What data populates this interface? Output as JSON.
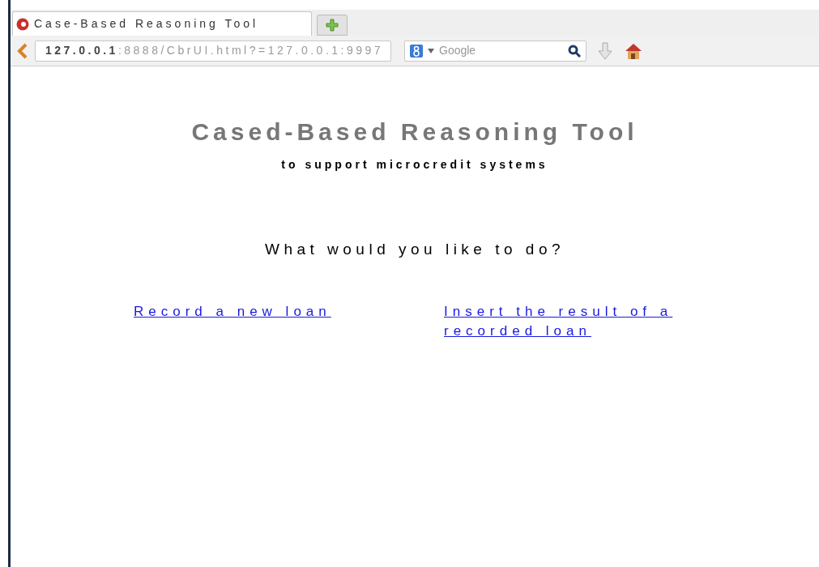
{
  "tabs": [
    {
      "title": "Case-Based Reasoning Tool",
      "selected": true
    }
  ],
  "address_bar": {
    "url": "**127.0.0.1**:8888/CbrUI.html?=127.0.0.1:9997"
  },
  "search": {
    "placeholder": "Google"
  },
  "page": {
    "title": "Cased-Based Reasoning Tool",
    "subtitle": "to support microcredit systems",
    "question": "What would you like to do?",
    "links": [
      "Record a new loan",
      "Insert the result of a recorded loan"
    ]
  }
}
